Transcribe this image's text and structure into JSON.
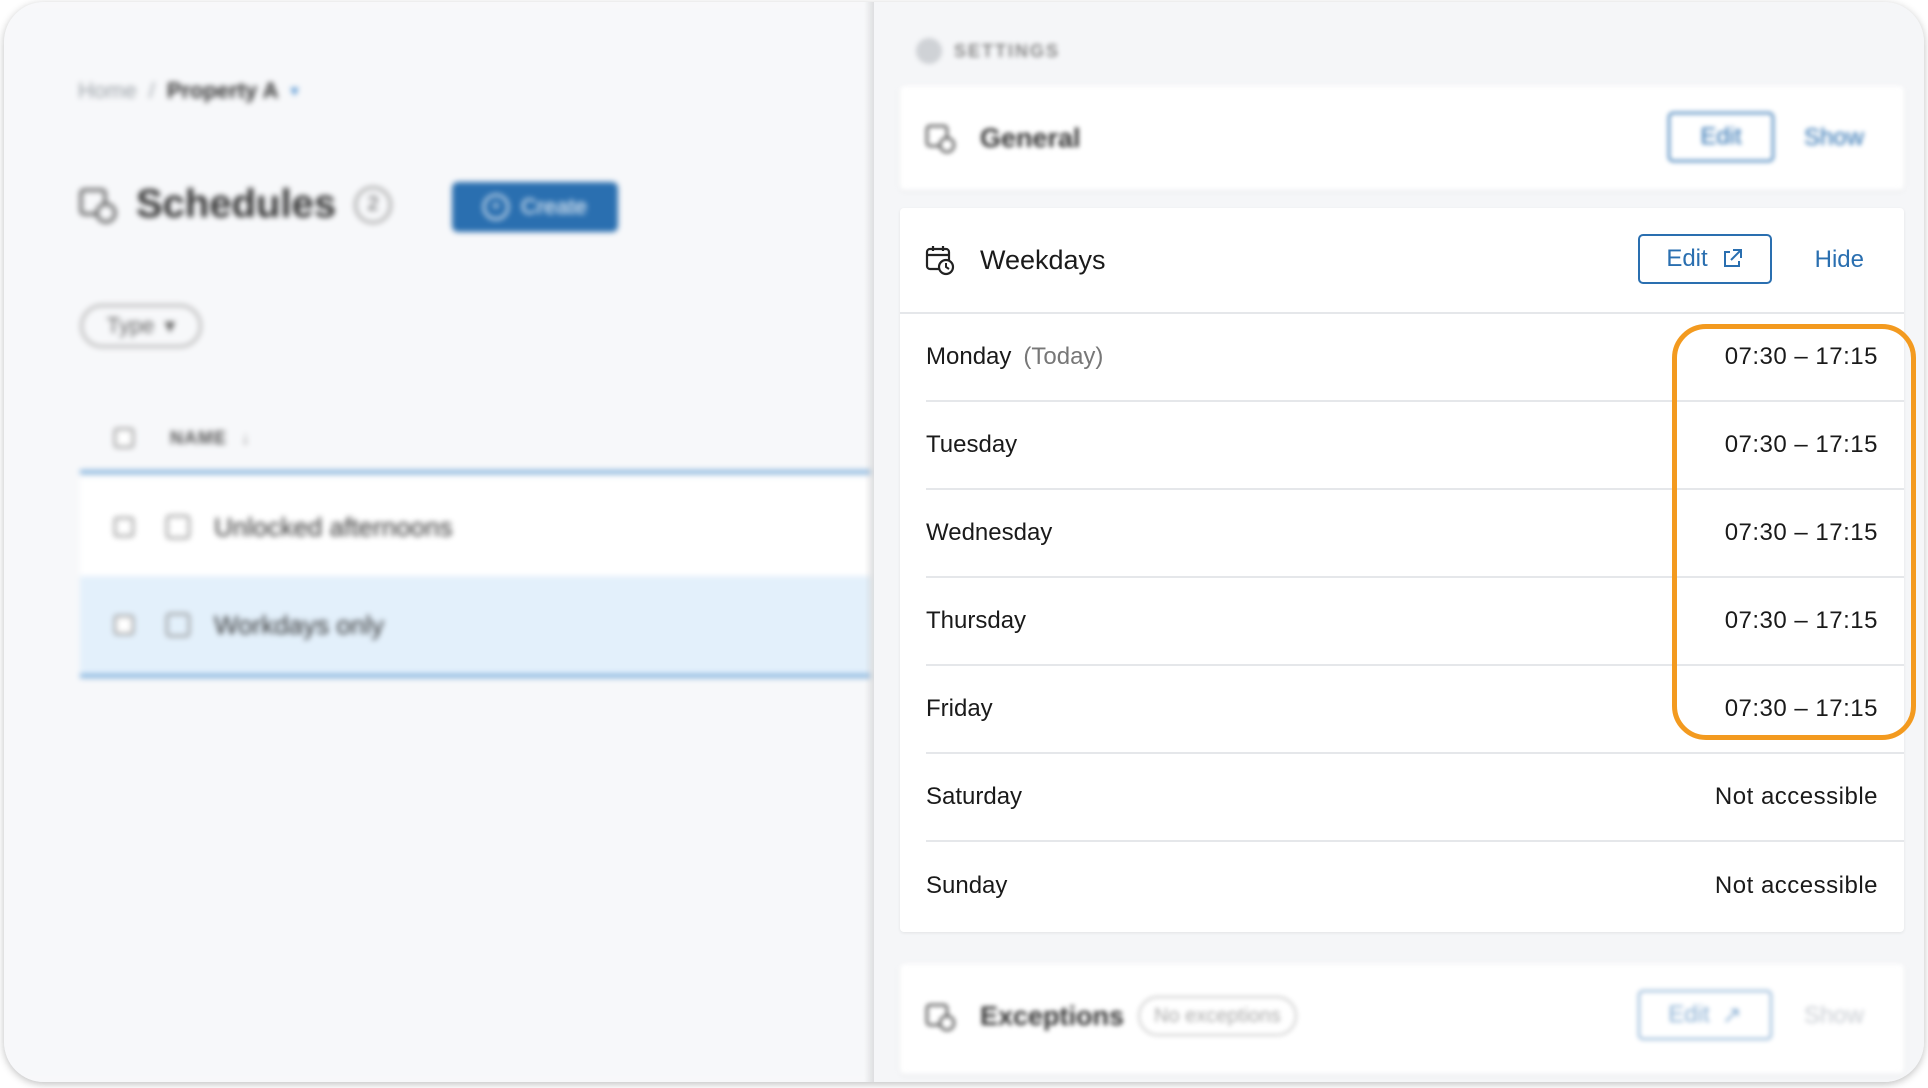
{
  "breadcrumb": {
    "home": "Home",
    "separator": "/",
    "current": "Property A"
  },
  "page": {
    "title": "Schedules",
    "count": "2",
    "create_label": "Create"
  },
  "filter": {
    "type_label": "Type"
  },
  "table": {
    "name_header": "NAME",
    "rows": [
      {
        "label": "Unlocked afternoons"
      },
      {
        "label": "Workdays only"
      }
    ]
  },
  "settings": {
    "heading": "SETTINGS",
    "general": {
      "title": "General",
      "edit_label": "Edit",
      "toggle_label": "Show"
    },
    "weekdays": {
      "title": "Weekdays",
      "edit_label": "Edit",
      "toggle_label": "Hide",
      "days": [
        {
          "name": "Monday",
          "note": "(Today)",
          "hours": "07:30 – 17:15"
        },
        {
          "name": "Tuesday",
          "note": "",
          "hours": "07:30 – 17:15"
        },
        {
          "name": "Wednesday",
          "note": "",
          "hours": "07:30 – 17:15"
        },
        {
          "name": "Thursday",
          "note": "",
          "hours": "07:30 – 17:15"
        },
        {
          "name": "Friday",
          "note": "",
          "hours": "07:30 – 17:15"
        },
        {
          "name": "Saturday",
          "note": "",
          "hours": "Not accessible"
        },
        {
          "name": "Sunday",
          "note": "",
          "hours": "Not accessible"
        }
      ]
    },
    "exceptions": {
      "title": "Exceptions",
      "pill": "No exceptions",
      "edit_label": "Edit",
      "toggle_label": "Show"
    }
  },
  "colors": {
    "accent": "#2a6fb0",
    "highlight": "#f39a1f",
    "selected_row": "#e3f0fb"
  },
  "icons": [
    "chevron-down-icon",
    "schedule-icon",
    "plus-circle-icon",
    "gear-icon",
    "calendar-icon",
    "external-link-icon"
  ]
}
